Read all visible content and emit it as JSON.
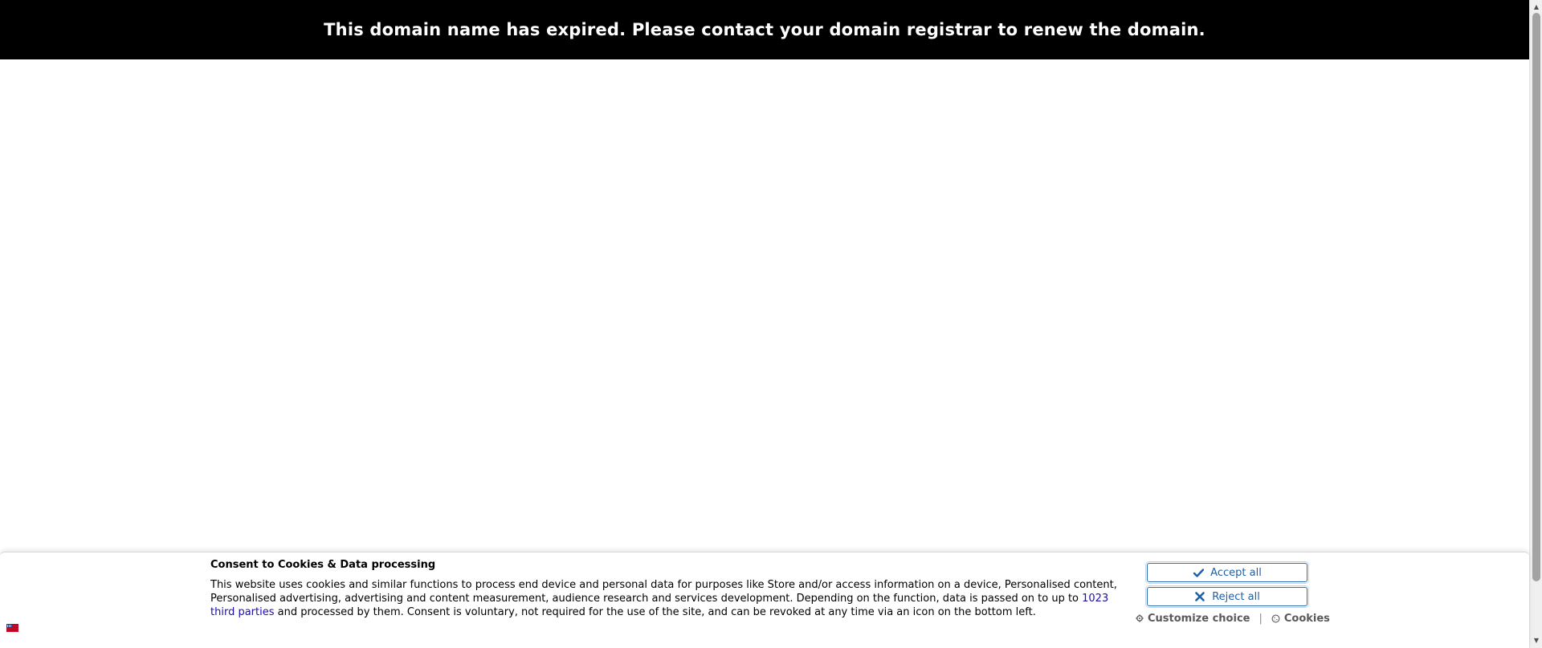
{
  "banner": {
    "message": "This domain name has expired. Please contact your domain registrar to renew the domain."
  },
  "consent": {
    "title": "Consent to Cookies & Data processing",
    "body_part1": "This website uses cookies and similar functions to process end device and personal data for purposes like Store and/or access information on a device, Personalised content, Personalised advertising, advertising and content measurement, audience research and services development. Depending on the function, data is passed on to up to ",
    "third_parties_link": "1023 third parties",
    "body_part2": " and processed by them. Consent is voluntary, not required for the use of the site, and can be revoked at any time via an icon on the bottom left.",
    "accept_label": "Accept all",
    "reject_label": "Reject all",
    "customize_label": "Customize choice",
    "separator": "|",
    "cookies_label": "Cookies",
    "language_flag": "uk-flag-icon"
  },
  "colors": {
    "banner_bg": "#000000",
    "banner_text": "#ffffff",
    "button_border": "#2f6db3",
    "button_text": "#1f5fa8",
    "link": "#1a0dab"
  }
}
